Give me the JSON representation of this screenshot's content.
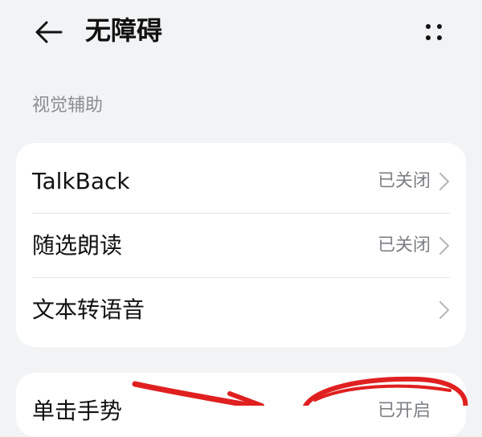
{
  "header": {
    "title": "无障碍",
    "back_icon": "back-arrow-icon",
    "more_icon": "more-dots-icon"
  },
  "section": {
    "label": "视觉辅助"
  },
  "items": [
    {
      "label": "TalkBack",
      "value": "已关闭"
    },
    {
      "label": "随选朗读",
      "value": "已关闭"
    },
    {
      "label": "文本转语音",
      "value": ""
    }
  ],
  "next_card": {
    "label": "单击手势",
    "value": "已开启"
  },
  "colors": {
    "background": "#f1f3f5",
    "card": "#ffffff",
    "annotation": "#e02020",
    "secondary_text": "#7c7f84"
  }
}
